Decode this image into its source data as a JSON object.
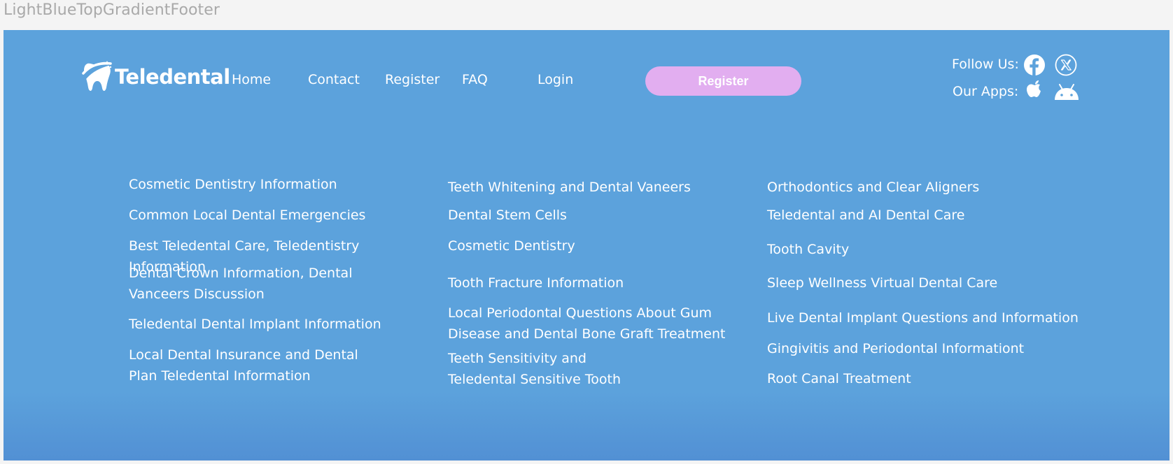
{
  "page_label": "LightBlueTopGradientFooter",
  "brand": {
    "name": "Teledental"
  },
  "nav": [
    {
      "label": "Home"
    },
    {
      "label": "Contact"
    },
    {
      "label": "Register"
    },
    {
      "label": "FAQ"
    },
    {
      "label": "Login"
    }
  ],
  "cta": {
    "label": "Register"
  },
  "social": {
    "follow_label": "Follow Us:",
    "apps_label": "Our Apps:"
  },
  "links": {
    "col1": [
      "Cosmetic Dentistry Information",
      "Common Local Dental Emergencies",
      "Best Teledental Care, Teledentistry Information",
      "Dental Crown Information, Dental Vanceers Discussion",
      "Teledental Dental Implant Information",
      "Local Dental Insurance and Dental Plan Teledental Information"
    ],
    "col2": [
      "Teeth Whitening and Dental Vaneers",
      "Dental Stem Cells",
      "Cosmetic Dentistry",
      "Tooth Fracture Information",
      "Local Periodontal Questions About Gum Disease and Dental Bone Graft Treatment",
      "Teeth Sensitivity and Teledental Sensitive Tooth"
    ],
    "col3": [
      "Orthodontics and Clear Aligners",
      "Teledental and AI Dental Care",
      "Tooth Cavity",
      "Sleep Wellness Virtual Dental Care",
      "Live Dental Implant Questions and Information",
      "Gingivitis and Periodontal Informationt",
      "Root Canal Treatment"
    ]
  },
  "colors": {
    "footer_bg": "#5ca2dc",
    "footer_bg_bottom": "#5290d4",
    "cta_bg": "#e2aef0",
    "text": "#ffffff",
    "page_bg": "#f4f4f4"
  },
  "icons": {
    "logo": "tooth-logo-icon",
    "facebook": "facebook-icon",
    "x": "x-twitter-icon",
    "apple": "apple-icon",
    "android": "android-icon"
  }
}
